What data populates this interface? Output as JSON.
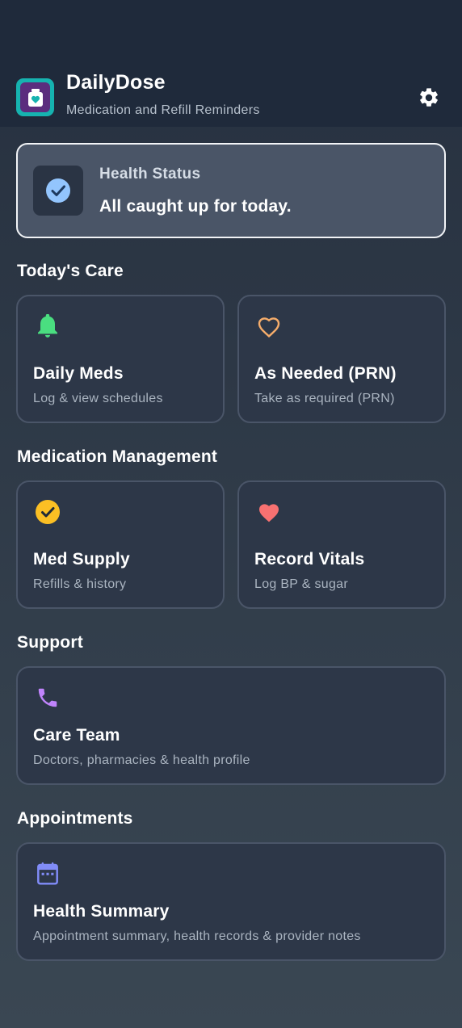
{
  "header": {
    "title": "DailyDose",
    "subtitle": "Medication and Refill Reminders",
    "settings_icon": "gear-icon"
  },
  "status": {
    "label": "Health Status",
    "message": "All caught up for today.",
    "icon": "check-circle-icon"
  },
  "sections": {
    "todays_care": "Today's Care",
    "medication_management": "Medication Management",
    "support": "Support",
    "appointments": "Appointments"
  },
  "cards": {
    "daily_meds": {
      "title": "Daily Meds",
      "subtitle": "Log & view schedules",
      "icon": "bell-icon",
      "color": "#4ade80"
    },
    "as_needed": {
      "title": "As Needed (PRN)",
      "subtitle": "Take as required (PRN)",
      "icon": "heart-outline-icon",
      "color": "#f6ad6b"
    },
    "med_supply": {
      "title": "Med Supply",
      "subtitle": "Refills & history",
      "icon": "check-circle-icon",
      "color": "#fbbf24"
    },
    "record_vitals": {
      "title": "Record Vitals",
      "subtitle": "Log BP & sugar",
      "icon": "heart-icon",
      "color": "#f87171"
    },
    "care_team": {
      "title": "Care Team",
      "subtitle": "Doctors, pharmacies & health profile",
      "icon": "phone-icon",
      "color": "#c084fc"
    },
    "health_summary": {
      "title": "Health Summary",
      "subtitle": "Appointment summary, health records & provider notes",
      "icon": "calendar-icon",
      "color": "#818cf8"
    }
  },
  "colors": {
    "header_bg": "#1f2a3b",
    "card_bg": "#2d3748",
    "status_bg": "#4a5567",
    "logo_teal": "#16b3b0",
    "logo_purple": "#5b2d7e"
  }
}
